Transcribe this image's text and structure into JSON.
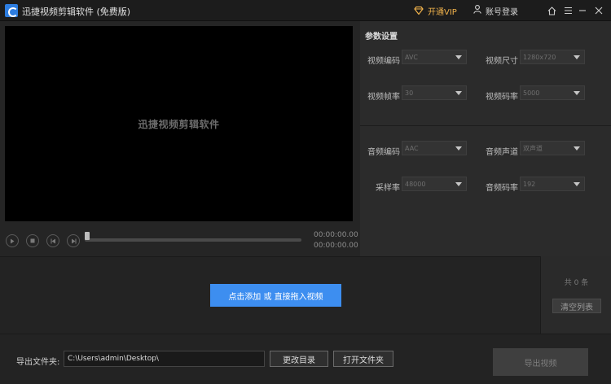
{
  "titlebar": {
    "title": "迅捷视频剪辑软件 (免费版)",
    "vip_label": "开通VIP",
    "login_label": "账号登录",
    "accent_vip": "#f0b24b"
  },
  "preview": {
    "placeholder": "迅捷视频剪辑软件"
  },
  "player": {
    "progress": 0,
    "current_time": "00:00:00.00",
    "total_time": "00:00:00.00"
  },
  "params": {
    "title": "参数设置",
    "video_codec": {
      "label": "视频编码",
      "value": "AVC"
    },
    "video_size": {
      "label": "视频尺寸",
      "value": "1280x720"
    },
    "frame_rate": {
      "label": "视频帧率",
      "value": "30"
    },
    "video_bitrate": {
      "label": "视频码率",
      "value": "5000"
    },
    "audio_codec": {
      "label": "音频编码",
      "value": "AAC"
    },
    "audio_channel": {
      "label": "音频声道",
      "value": "双声道"
    },
    "sample_rate": {
      "label": "采样率",
      "value": "48000"
    },
    "audio_bitrate": {
      "label": "音频码率",
      "value": "192"
    }
  },
  "list": {
    "add_label": "点击添加 或 直接拖入视频",
    "count_text": "共 0 条",
    "clear_label": "清空列表",
    "accent": "#3d8ef0"
  },
  "export": {
    "folder_label": "导出文件夹:",
    "folder_path": "C:\\Users\\admin\\Desktop\\",
    "change_dir_label": "更改目录",
    "open_folder_label": "打开文件夹",
    "export_label": "导出视频"
  },
  "icons": {
    "app": "app-logo-icon",
    "vip": "diamond-icon",
    "login": "user-icon",
    "home": "home-icon",
    "settings": "list-icon",
    "minimize": "minimize-icon",
    "close": "close-icon",
    "play": "play-icon",
    "stop": "stop-icon",
    "prev": "prev-frame-icon",
    "next": "next-frame-icon"
  }
}
